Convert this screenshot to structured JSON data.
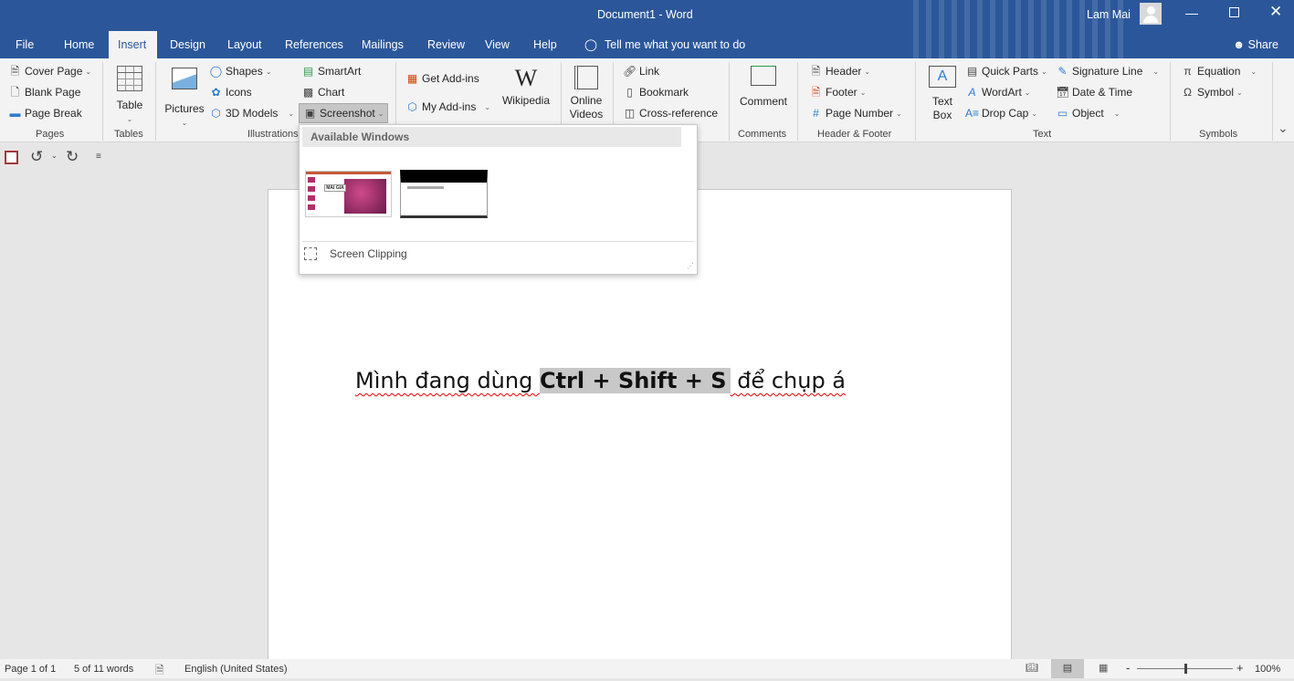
{
  "title": {
    "doc": "Document1  -  Word",
    "user": "Lam Mai"
  },
  "tabs": [
    "File",
    "Home",
    "Insert",
    "Design",
    "Layout",
    "References",
    "Mailings",
    "Review",
    "View",
    "Help"
  ],
  "tell_me": "Tell me what you want to do",
  "share": "Share",
  "ribbon": {
    "pages": {
      "label": "Pages",
      "items": [
        "Cover Page",
        "Blank Page",
        "Page Break"
      ]
    },
    "tables": {
      "label": "Tables",
      "table": "Table"
    },
    "illustrations": {
      "label": "Illustrations",
      "pictures": "Pictures",
      "shapes": "Shapes",
      "icons": "Icons",
      "models": "3D Models",
      "smartart": "SmartArt",
      "chart": "Chart",
      "screenshot": "Screenshot"
    },
    "addins": {
      "get": "Get Add-ins",
      "my": "My Add-ins",
      "wikipedia": "Wikipedia"
    },
    "media": {
      "online_videos_1": "Online",
      "online_videos_2": "Videos"
    },
    "links": {
      "link": "Link",
      "bookmark": "Bookmark",
      "crossref": "Cross-reference"
    },
    "comments": {
      "label": "Comments",
      "comment": "Comment"
    },
    "header_footer": {
      "label": "Header & Footer",
      "header": "Header",
      "footer": "Footer",
      "page_number": "Page Number"
    },
    "text": {
      "label": "Text",
      "textbox_1": "Text",
      "textbox_2": "Box",
      "quick_parts": "Quick Parts",
      "wordart": "WordArt",
      "drop_cap": "Drop Cap",
      "signature": "Signature Line",
      "datetime": "Date & Time",
      "object": "Object"
    },
    "symbols": {
      "label": "Symbols",
      "equation": "Equation",
      "symbol": "Symbol"
    }
  },
  "dropdown": {
    "header": "Available Windows",
    "thumb1_text": "MAI GIA",
    "screen_clipping": "Screen Clipping"
  },
  "document": {
    "before": "Mình đang dùng ",
    "selected": "Ctrl + Shift + S",
    "after": " để chụp á"
  },
  "status": {
    "page": "Page 1 of 1",
    "words": "5 of 11 words",
    "language": "English (United States)",
    "zoom": "100%",
    "zoom_level": 100
  },
  "colors": {
    "brand": "#2b579a",
    "selection": "#c8c8c8"
  }
}
